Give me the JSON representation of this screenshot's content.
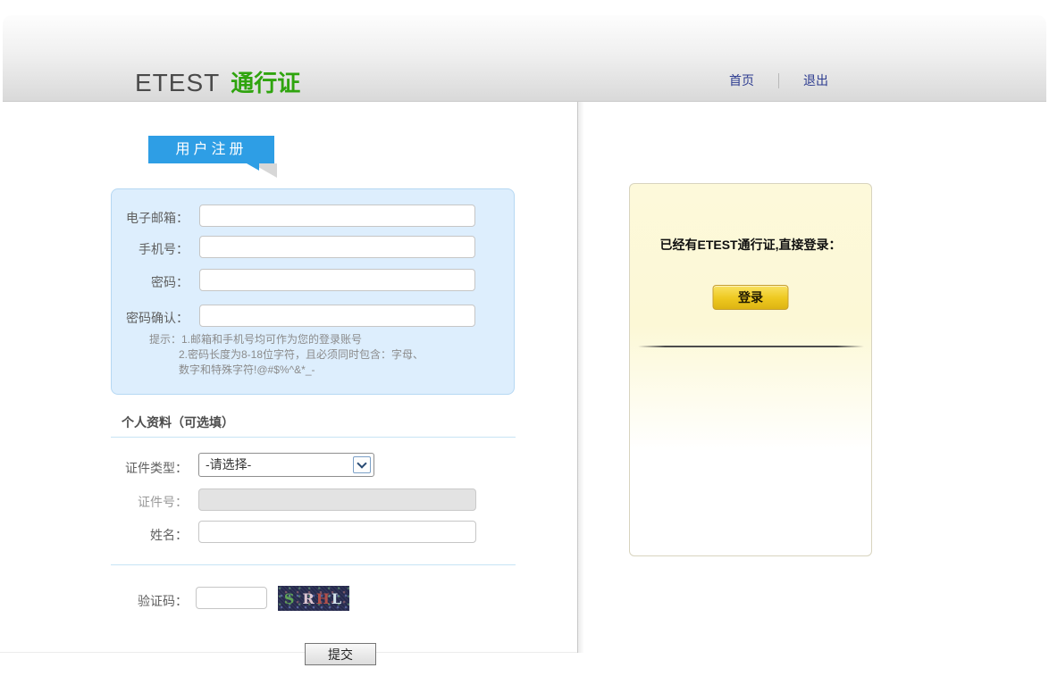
{
  "header": {
    "logo": {
      "en": "ETEST",
      "cn": "通行证"
    },
    "nav": {
      "home": "首页",
      "logout": "退出"
    }
  },
  "register": {
    "tab_title": "用户注册",
    "email": {
      "label": "电子邮箱：",
      "value": ""
    },
    "phone": {
      "label": "手机号：",
      "value": ""
    },
    "password": {
      "label": "密码：",
      "value": ""
    },
    "password_confirm": {
      "label": "密码确认：",
      "value": ""
    },
    "tips": {
      "line1": "提示：1.邮箱和手机号均可作为您的登录账号",
      "line2": "2.密码长度为8-18位字符，且必须同时包含：字母、",
      "line3": "数字和特殊字符!@#$%^&*_-"
    },
    "personal": {
      "heading": "个人资料（可选填）",
      "id_type": {
        "label": "证件类型：",
        "selected": "-请选择-"
      },
      "id_number": {
        "label": "证件号：",
        "value": ""
      },
      "name": {
        "label": "姓名：",
        "value": ""
      }
    },
    "captcha": {
      "label": "验证码：",
      "value": "",
      "image_text": "S RHL",
      "letters": [
        "S",
        "R",
        "H",
        "L"
      ],
      "letter_colors": [
        "#5fa357",
        "#dcc6d2",
        "#b2504b",
        "#d3e3ec"
      ]
    },
    "submit_label": "提交"
  },
  "login_panel": {
    "prompt": "已经有ETEST通行证,直接登录：",
    "button_label": "登录"
  },
  "colors": {
    "brand_green": "#2fa40e",
    "tab_blue": "#2e9ee5",
    "panel_blue_bg": "#ddeefd",
    "link_navy": "#2d3c90",
    "login_gold": "#eec81f",
    "login_panel_cream": "#fdf9da"
  }
}
